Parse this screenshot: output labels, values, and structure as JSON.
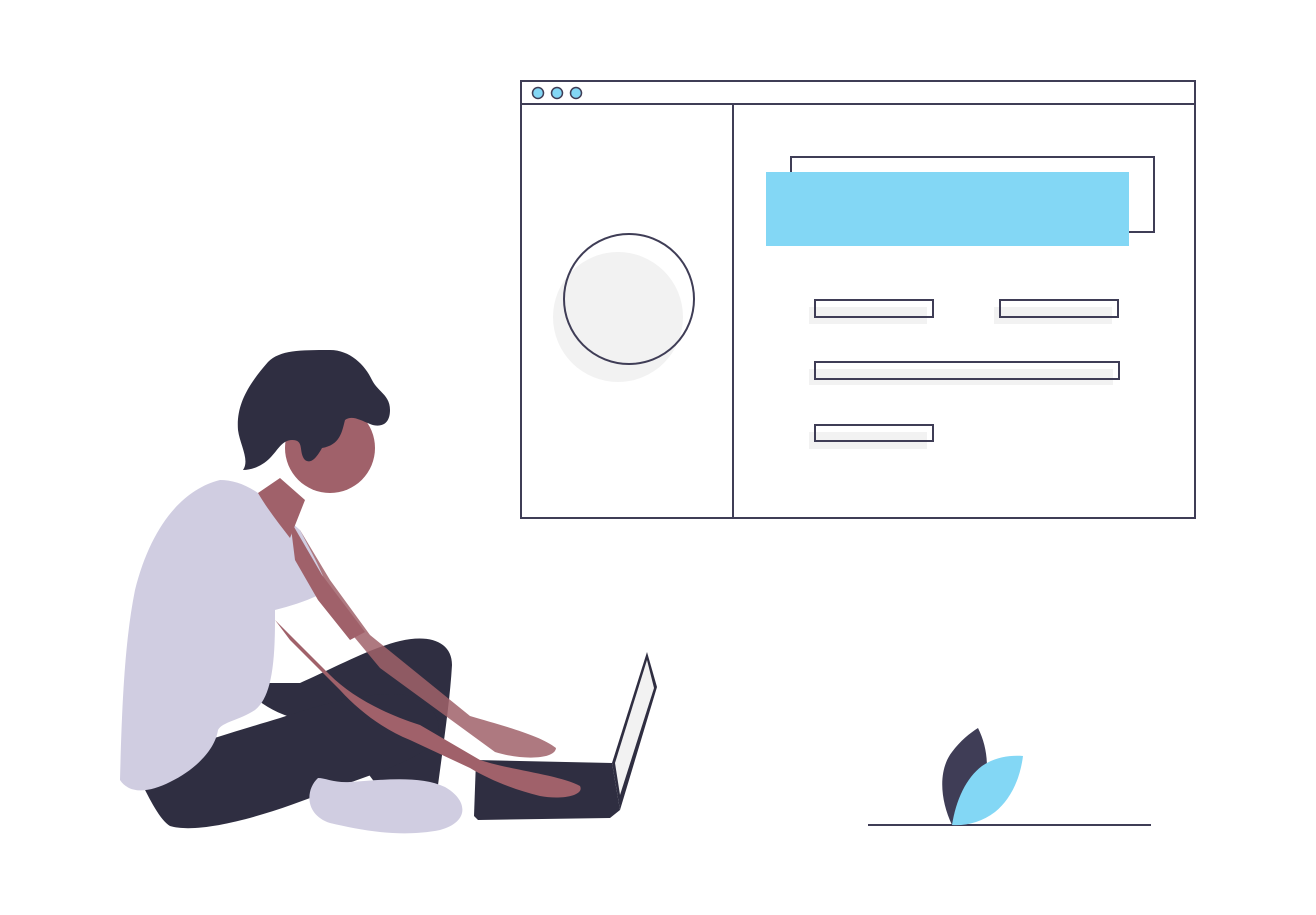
{
  "illustration": {
    "colors": {
      "outline": "#3f3d56",
      "accent": "#83d7f5",
      "placeholder_fill": "#f2f2f2",
      "shirt": "#d0cde1",
      "hair_and_pants": "#2f2e41",
      "skin": "#a0616a",
      "laptop_screen": "#f2f2f2",
      "plant_dark_leaf": "#3f3d56",
      "plant_light_leaf": "#83d7f5"
    },
    "browser_window": {
      "control_dots": [
        "control-dot",
        "control-dot",
        "control-dot"
      ],
      "sidebar": {
        "avatar_shape": "circle"
      },
      "main": {
        "header_block": "filled-bar",
        "field_rows": [
          [
            "short-field",
            "short-field"
          ],
          [
            "wide-field"
          ],
          [
            "short-field"
          ]
        ]
      }
    },
    "figure": {
      "pose": "seated-cross-legged",
      "device": "laptop"
    },
    "plant": {
      "leaves": [
        "dark-leaf",
        "light-leaf"
      ]
    }
  }
}
